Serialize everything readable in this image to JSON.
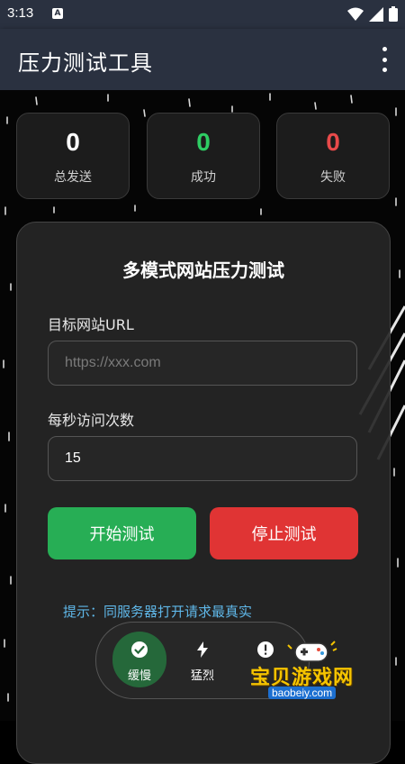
{
  "status_bar": {
    "time": "3:13",
    "notification_icon": "a-icon"
  },
  "app_bar": {
    "title": "压力测试工具",
    "menu_icon": "more-vert-icon"
  },
  "stats": [
    {
      "value": "0",
      "label": "总发送",
      "color": "#ffffff"
    },
    {
      "value": "0",
      "label": "成功",
      "color": "#2ecc63"
    },
    {
      "value": "0",
      "label": "失败",
      "color": "#e84a4a"
    }
  ],
  "card": {
    "heading": "多模式网站压力测试",
    "url_label": "目标网站URL",
    "url_placeholder": "https://xxx.com",
    "url_value": "",
    "rate_label": "每秒访问次数",
    "rate_value": "15",
    "start_label": "开始测试",
    "stop_label": "停止测试"
  },
  "tip": "提示：同服务器打开请求最真实",
  "modes": [
    {
      "label": "缓慢",
      "icon": "check-circle-icon",
      "active": true
    },
    {
      "label": "猛烈",
      "icon": "bolt-icon",
      "active": false
    },
    {
      "label": "",
      "icon": "alert-circle-icon",
      "active": false
    }
  ],
  "watermark": {
    "text": "宝贝游戏网",
    "url": "baobeiy.com"
  },
  "colors": {
    "appbar": "#2a3140",
    "success": "#27ae55",
    "danger": "#e03434",
    "tip": "#5fb7e8"
  }
}
